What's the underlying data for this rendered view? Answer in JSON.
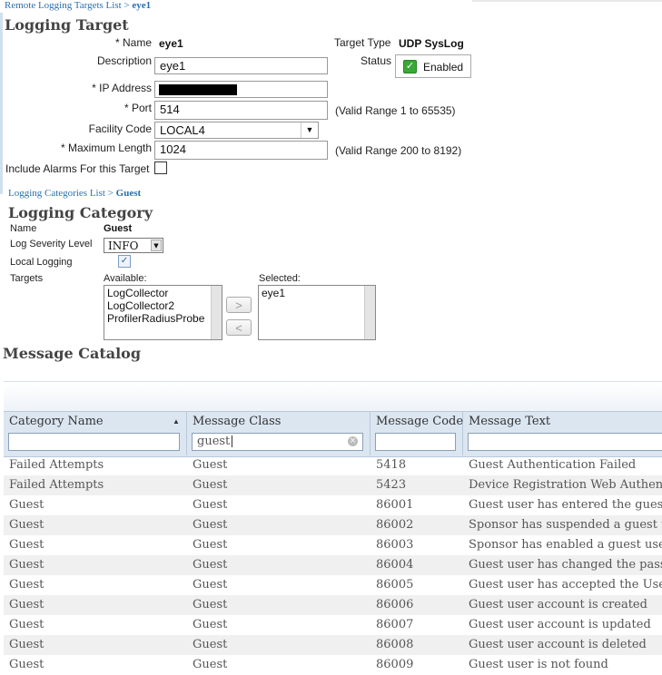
{
  "breadcrumb_top": {
    "link": "Remote Logging Targets List",
    "sep": ">",
    "current": "eye1"
  },
  "logging_target": {
    "title": "Logging Target",
    "name_label": "* Name",
    "name_value": "eye1",
    "target_type_label": "Target Type",
    "target_type_value": "UDP SysLog",
    "description_label": "Description",
    "description_value": "eye1",
    "status_label": "Status",
    "status_value": "Enabled",
    "ip_label": "* IP Address",
    "port_label": "* Port",
    "port_value": "514",
    "port_hint": "(Valid Range 1 to 65535)",
    "facility_label": "Facility Code",
    "facility_value": "LOCAL4",
    "maxlen_label": "* Maximum Length",
    "maxlen_value": "1024",
    "maxlen_hint": "(Valid Range 200 to 8192)",
    "include_alarms_label": "Include Alarms For this Target"
  },
  "breadcrumb_cat": {
    "link": "Logging Categories List",
    "sep": ">",
    "current": "Guest"
  },
  "logging_category": {
    "title": "Logging Category",
    "name_label": "Name",
    "name_value": "Guest",
    "severity_label": "Log Severity Level",
    "severity_value": "INFO",
    "local_logging_label": "Local Logging",
    "targets_label": "Targets",
    "available_label": "Available:",
    "available_items": [
      "LogCollector",
      "LogCollector2",
      "ProfilerRadiusProbe"
    ],
    "selected_label": "Selected:",
    "selected_items": [
      "eye1"
    ],
    "move_right": ">",
    "move_left": "<"
  },
  "catalog": {
    "title": "Message Catalog",
    "columns": [
      "Category Name",
      "Message Class",
      "Message Code",
      "Message Text"
    ],
    "filter_class": "guest",
    "rows": [
      [
        "Failed Attempts",
        "Guest",
        "5418",
        "Guest Authentication Failed"
      ],
      [
        "Failed Attempts",
        "Guest",
        "5423",
        "Device Registration Web Authentic"
      ],
      [
        "Guest",
        "Guest",
        "86001",
        "Guest user has entered the guest p"
      ],
      [
        "Guest",
        "Guest",
        "86002",
        "Sponsor has suspended a guest use"
      ],
      [
        "Guest",
        "Guest",
        "86003",
        "Sponsor has enabled a guest user a"
      ],
      [
        "Guest",
        "Guest",
        "86004",
        "Guest user has changed the passw"
      ],
      [
        "Guest",
        "Guest",
        "86005",
        "Guest user has accepted the Use P"
      ],
      [
        "Guest",
        "Guest",
        "86006",
        "Guest user account is created"
      ],
      [
        "Guest",
        "Guest",
        "86007",
        "Guest user account is updated"
      ],
      [
        "Guest",
        "Guest",
        "86008",
        "Guest user account is deleted"
      ],
      [
        "Guest",
        "Guest",
        "86009",
        "Guest user is not found"
      ]
    ]
  }
}
